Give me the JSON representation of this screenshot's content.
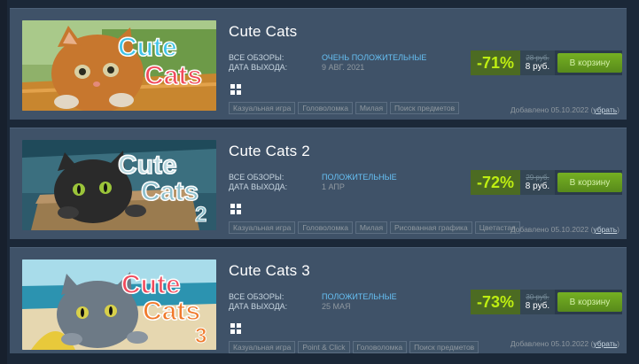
{
  "items": [
    {
      "title": "Cute Cats",
      "capsule_logo": [
        "Cute",
        "Cats"
      ],
      "capsule_sub": "",
      "reviews_label": "ВСЕ ОБЗОРЫ:",
      "reviews_value": "ОЧЕНЬ ПОЛОЖИТЕЛЬНЫЕ",
      "release_label": "ДАТА ВЫХОДА:",
      "release_value": "9 АВГ. 2021",
      "tags": [
        "Казуальная игра",
        "Головоломка",
        "Милая",
        "Поиск предметов"
      ],
      "discount": "-71%",
      "original_price": "28 руб.",
      "final_price": "8 руб.",
      "cart_label": "В корзину",
      "added_text": "Добавлено 05.10.2022",
      "remove_label": "убрать"
    },
    {
      "title": "Cute Cats 2",
      "capsule_logo": [
        "Cute",
        "Cats"
      ],
      "capsule_sub": "2",
      "reviews_label": "ВСЕ ОБЗОРЫ:",
      "reviews_value": "ПОЛОЖИТЕЛЬНЫЕ",
      "release_label": "ДАТА ВЫХОДА:",
      "release_value": "1 АПР",
      "tags": [
        "Казуальная игра",
        "Головоломка",
        "Милая",
        "Рисованная графика",
        "Цветастая"
      ],
      "discount": "-72%",
      "original_price": "29 руб.",
      "final_price": "8 руб.",
      "cart_label": "В корзину",
      "added_text": "Добавлено 05.10.2022",
      "remove_label": "убрать"
    },
    {
      "title": "Cute Cats 3",
      "capsule_logo": [
        "Cute",
        "Cats"
      ],
      "capsule_sub": "3",
      "reviews_label": "ВСЕ ОБЗОРЫ:",
      "reviews_value": "ПОЛОЖИТЕЛЬНЫЕ",
      "release_label": "ДАТА ВЫХОДА:",
      "release_value": "25 МАЯ",
      "tags": [
        "Казуальная игра",
        "Point & Click",
        "Головоломка",
        "Поиск предметов"
      ],
      "discount": "-73%",
      "original_price": "30 руб.",
      "final_price": "8 руб.",
      "cart_label": "В корзину",
      "added_text": "Добавлено 05.10.2022",
      "remove_label": "убрать"
    }
  ],
  "icons": {
    "platform": "windows-icon"
  },
  "colors": {
    "background": "#1b2838",
    "row": "#3f5268",
    "discount_bg": "#4c6b22",
    "discount_text": "#beee11",
    "cart_button": "#75b022",
    "positive_review": "#66c0f4"
  }
}
